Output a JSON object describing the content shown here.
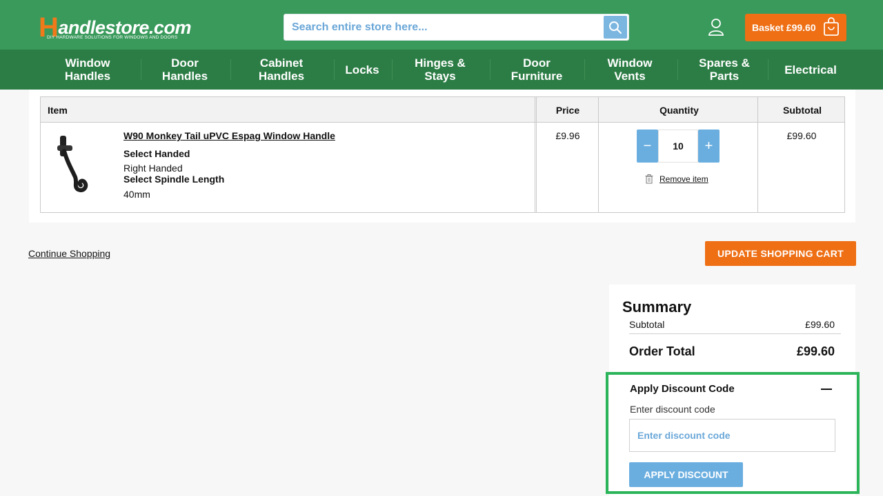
{
  "header": {
    "logo_main": "andlestore.com",
    "logo_initial": "H",
    "logo_tagline": "DIY HARDWARE SOLUTIONS FOR WINDOWS AND DOORS",
    "search_placeholder": "Search entire store here...",
    "search_icon": "search-icon",
    "account_icon": "user-icon",
    "basket_label": "Basket £99.60",
    "basket_icon": "shopping-bag-icon"
  },
  "nav": {
    "items": [
      {
        "label": "Window\nHandles"
      },
      {
        "label": "Door\nHandles"
      },
      {
        "label": "Cabinet\nHandles"
      },
      {
        "label": "Locks"
      },
      {
        "label": "Hinges &\nStays"
      },
      {
        "label": "Door\nFurniture"
      },
      {
        "label": "Window\nVents"
      },
      {
        "label": "Spares &\nParts"
      },
      {
        "label": "Electrical"
      }
    ]
  },
  "cart": {
    "columns": {
      "item": "Item",
      "price": "Price",
      "quantity": "Quantity",
      "subtotal": "Subtotal"
    },
    "rows": [
      {
        "name": "W90 Monkey Tail uPVC Espag Window Handle",
        "option1_label": "Select Handed",
        "option1_value": "Right Handed",
        "option2_label": "Select Spindle Length",
        "option2_value": "40mm",
        "price": "£9.96",
        "quantity": "10",
        "subtotal": "£99.60",
        "remove_label": "Remove item",
        "minus_label": "−",
        "plus_label": "+"
      }
    ],
    "continue_label": "Continue Shopping",
    "update_label": "UPDATE SHOPPING CART"
  },
  "summary": {
    "title": "Summary",
    "subtotal_label": "Subtotal",
    "subtotal_value": "£99.60",
    "total_label": "Order Total",
    "total_value": "£99.60"
  },
  "discount": {
    "title": "Apply Discount Code",
    "field_label": "Enter discount code",
    "placeholder": "Enter discount code",
    "button_label": "APPLY DISCOUNT"
  },
  "colors": {
    "header_green": "#3a9a5c",
    "nav_green": "#2c7d45",
    "accent_orange": "#ee6f14",
    "button_blue": "#6aaee0",
    "highlight_green": "#2cb45a"
  }
}
